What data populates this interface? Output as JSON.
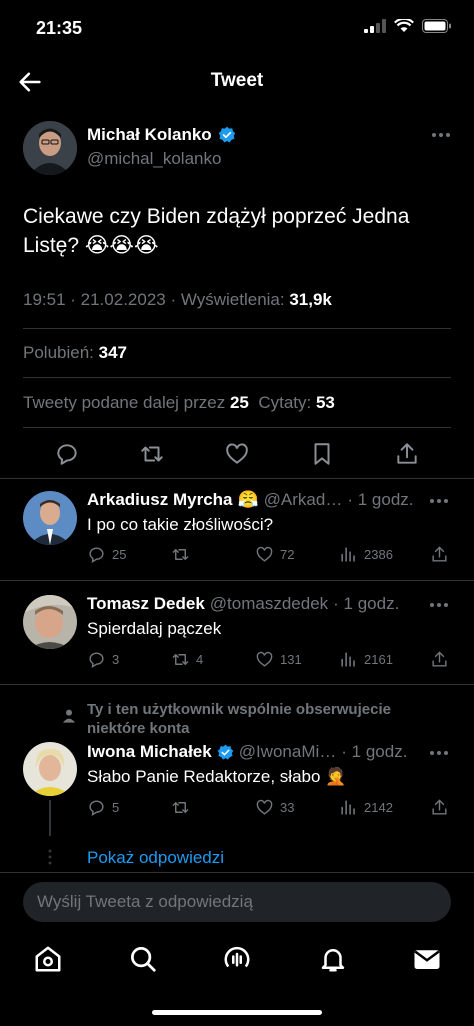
{
  "status": {
    "time": "21:35"
  },
  "nav": {
    "title": "Tweet"
  },
  "tweet": {
    "name": "Michał Kolanko",
    "handle": "@michal_kolanko",
    "text": "Ciekawe czy Biden zdążył poprzeć Jedna Listę? 😭😭😭",
    "time": "19:51 · 21.02.2023 · ",
    "views_label": "Wyświetlenia: ",
    "views": "31,9k",
    "likes_label": "Polubień: ",
    "likes": "347",
    "retweets_label": "Tweety podane dalej przez ",
    "retweets": "25",
    "quotes_label": "Cytaty: ",
    "quotes": "53"
  },
  "replies": [
    {
      "name": "Arkadiusz Myrcha",
      "emoji": "😤",
      "handle": "@Arkad…",
      "time": "· 1 godz.",
      "text": "I po co takie złośliwości?",
      "replies": "25",
      "retweets": "",
      "likes": "72",
      "views": "2386"
    },
    {
      "name": "Tomasz Dedek",
      "handle": "@tomaszdedek",
      "time": "· 1 godz.",
      "text": "Spierdalaj pączek",
      "replies": "3",
      "retweets": "4",
      "likes": "131",
      "views": "2161"
    },
    {
      "social_context": "Ty i ten użytkownik wspólnie obserwujecie niektóre konta",
      "name": "Iwona Michałek",
      "handle": "@IwonaMi…",
      "time": "· 1 godz.",
      "text": "Słabo Panie Redaktorze, słabo 🤦",
      "replies": "5",
      "retweets": "",
      "likes": "33",
      "views": "2142"
    }
  ],
  "show_replies": "Pokaż odpowiedzi",
  "compose": {
    "placeholder": "Wyślij Tweeta z odpowiedzią"
  },
  "colors": {
    "accent": "#1d9bf0",
    "muted": "#71767b",
    "background": "#000000"
  }
}
